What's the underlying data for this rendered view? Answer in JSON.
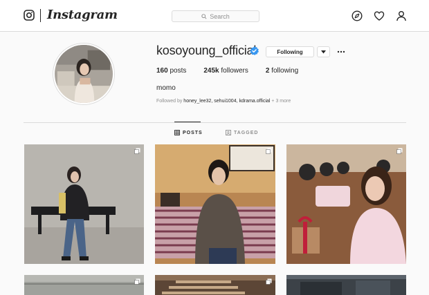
{
  "header": {
    "wordmark": "Instagram",
    "search_placeholder": "Search",
    "icons": [
      "instagram-glyph-icon",
      "search-icon",
      "compass-icon",
      "heart-icon",
      "person-icon"
    ]
  },
  "profile": {
    "username": "kosoyoung_official",
    "verified": true,
    "follow_label": "Following",
    "posts_count": "160",
    "posts_label": "posts",
    "followers_count": "245k",
    "followers_label": "followers",
    "following_count": "2",
    "following_label": "following",
    "bio_name": "momo",
    "followed_by_prefix": "Followed by ",
    "followed_by_users": "honey_lee32, sehui1004, kdrama.official",
    "followed_by_suffix": " + 3 more"
  },
  "tabs": [
    {
      "label": "POSTS",
      "active": true,
      "icon": "grid-icon"
    },
    {
      "label": "TAGGED",
      "active": false,
      "icon": "tag-icon"
    }
  ],
  "posts": [
    {
      "name": "post-1",
      "multi": true
    },
    {
      "name": "post-2",
      "multi": true
    },
    {
      "name": "post-3",
      "multi": true
    },
    {
      "name": "post-4",
      "multi": true
    },
    {
      "name": "post-5",
      "multi": true
    },
    {
      "name": "post-6",
      "multi": false
    }
  ],
  "colors": {
    "verified_blue": "#3897f0",
    "border": "#dbdbdb",
    "background": "#fafafa",
    "text": "#262626",
    "muted": "#8e8e8e"
  }
}
